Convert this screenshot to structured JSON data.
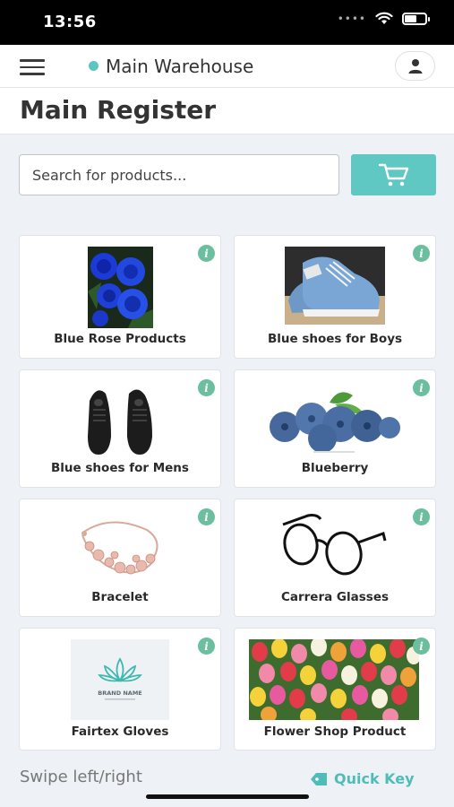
{
  "status_bar": {
    "time": "13:56",
    "battery_level": 0.6
  },
  "header": {
    "location_name": "Main Warehouse",
    "location_color": "#5bc5c0"
  },
  "page": {
    "title": "Main Register"
  },
  "search": {
    "placeholder": "Search for products..."
  },
  "colors": {
    "accent": "#5fc8c2",
    "info_badge": "#6bbf9e"
  },
  "products": [
    {
      "label": "Blue Rose Products",
      "image": "blue-roses-image"
    },
    {
      "label": "Blue shoes for Boys",
      "image": "blue-sneakers-image"
    },
    {
      "label": "Blue shoes for Mens",
      "image": "black-shoes-image"
    },
    {
      "label": "Blueberry",
      "image": "blueberries-image"
    },
    {
      "label": "Bracelet",
      "image": "bracelet-image"
    },
    {
      "label": "Carrera Glasses",
      "image": "glasses-image"
    },
    {
      "label": "Fairtex Gloves",
      "image": "brand-logo-image",
      "image_text": "BRAND NAME"
    },
    {
      "label": "Flower Shop Product",
      "image": "tulips-image"
    }
  ],
  "footer": {
    "hint": "Swipe left/right",
    "quick_key_label": "Quick Key"
  }
}
